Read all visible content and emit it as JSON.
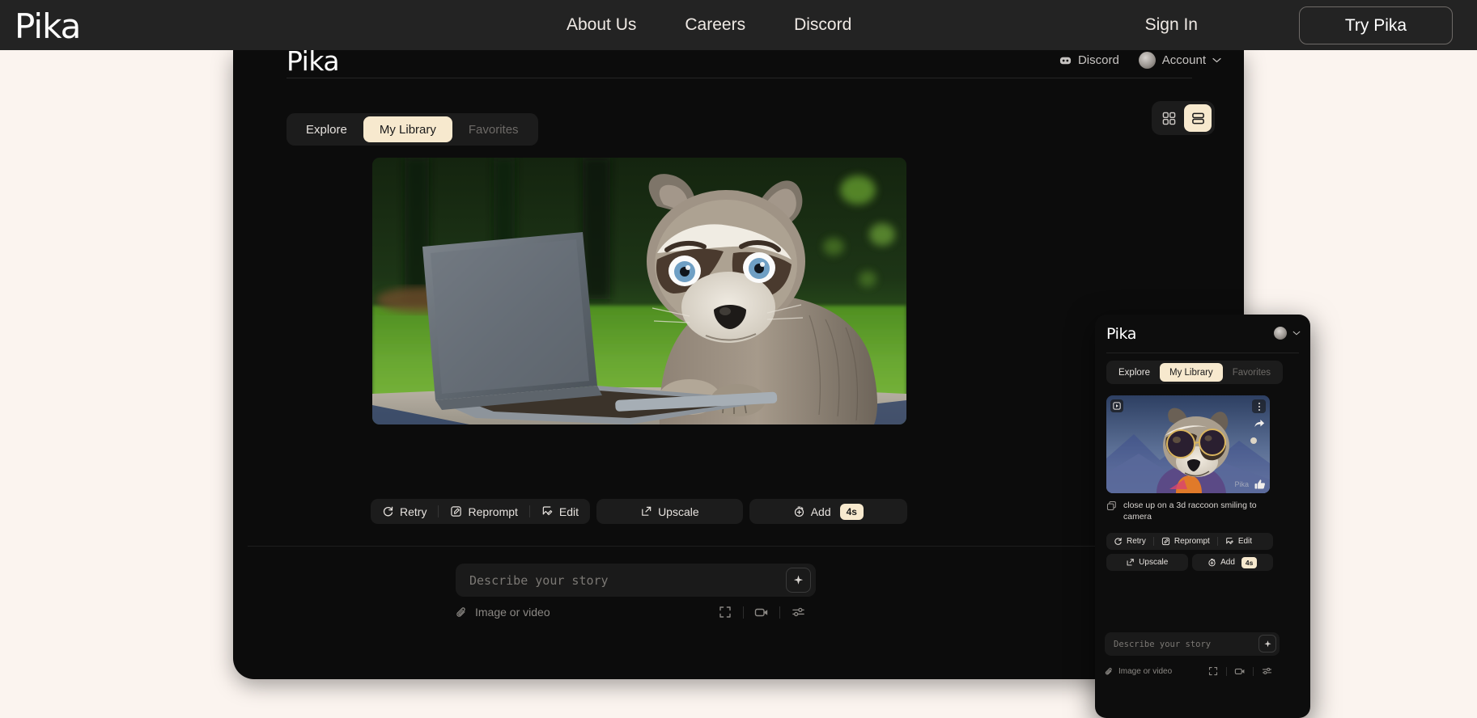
{
  "topnav": {
    "brand": "Pika",
    "links": [
      {
        "label": "About Us"
      },
      {
        "label": "Careers"
      },
      {
        "label": "Discord"
      }
    ],
    "signin_label": "Sign In",
    "try_label": "Try Pika"
  },
  "app": {
    "logo": "Pika",
    "discord_label": "Discord",
    "account_label": "Account",
    "tabs": [
      {
        "label": "Explore",
        "state": "normal"
      },
      {
        "label": "My Library",
        "state": "active"
      },
      {
        "label": "Favorites",
        "state": "dim"
      }
    ],
    "view_toggle": {
      "grid_icon": "grid-view-icon",
      "list_icon": "list-view-icon",
      "active": "list"
    },
    "hero": {
      "alt": "3d raccoon typing on a laptop on grass",
      "icon": "video-thumbnail"
    },
    "actions": {
      "retry": "Retry",
      "reprompt": "Reprompt",
      "edit": "Edit",
      "upscale": "Upscale",
      "add": "Add",
      "add_badge": "4s"
    },
    "prompt": {
      "placeholder": "Describe your story",
      "submit_icon": "sparkle-icon",
      "attach_label": "Image or video",
      "tool_icons": [
        "expand-icon",
        "video-camera-icon",
        "settings-sliders-icon"
      ]
    }
  },
  "mobile": {
    "logo": "Pika",
    "tabs": [
      {
        "label": "Explore",
        "state": "normal"
      },
      {
        "label": "My Library",
        "state": "active"
      },
      {
        "label": "Favorites",
        "state": "dim"
      }
    ],
    "card": {
      "caption": "close up on a 3d raccoon smiling to camera",
      "watermark": "Pika",
      "overlay_icons": [
        "play-badge-icon",
        "kebab-menu-icon",
        "share-icon",
        "thumbs-up-icon"
      ]
    },
    "actions": {
      "retry": "Retry",
      "reprompt": "Reprompt",
      "edit": "Edit",
      "upscale": "Upscale",
      "add": "Add",
      "add_badge": "4s"
    },
    "prompt": {
      "placeholder": "Describe your story",
      "attach_label": "Image or video"
    }
  },
  "colors": {
    "page_bg": "#FBF4EF",
    "nav_bg": "#232323",
    "panel_bg": "#0C0C0C",
    "accent_cream": "#F7E9CE",
    "text_primary": "#E7E3DF",
    "text_dim": "#6D6A67"
  }
}
